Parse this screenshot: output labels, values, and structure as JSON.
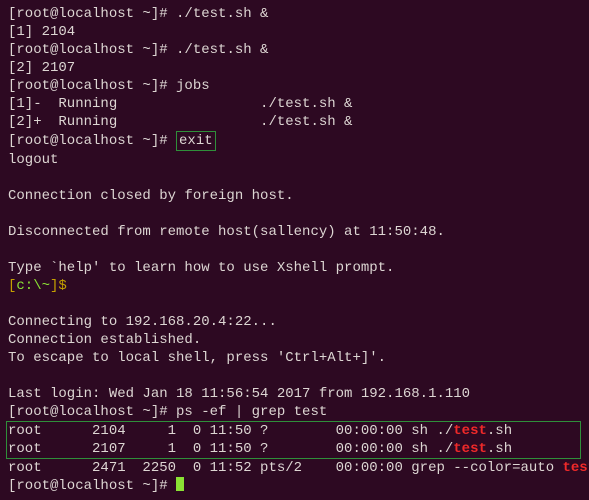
{
  "lines": {
    "prompt1": "[root@localhost ~]# ",
    "cmd1": "./test.sh &",
    "bg1": "[1] 2104",
    "prompt2": "[root@localhost ~]# ",
    "cmd2": "./test.sh &",
    "bg2": "[2] 2107",
    "prompt3": "[root@localhost ~]# ",
    "cmd3": "jobs",
    "jobs1": "[1]-  Running                 ./test.sh &",
    "jobs2": "[2]+  Running                 ./test.sh &",
    "prompt4": "[root@localhost ~]# ",
    "cmd4": "exit",
    "logout": "logout",
    "closed": "Connection closed by foreign host.",
    "disconnected": "Disconnected from remote host(sallency) at 11:50:48.",
    "help": "Type `help' to learn how to use Xshell prompt.",
    "localprompt": "[c:\\~]$",
    "connecting": "Connecting to 192.168.20.4:22...",
    "established": "Connection established.",
    "escape": "To escape to local shell, press 'Ctrl+Alt+]'.",
    "lastlogin": "Last login: Wed Jan 18 11:56:54 2017 from 192.168.1.110",
    "prompt5": "[root@localhost ~]# ",
    "cmd5": "ps -ef | grep test",
    "ps1a": "root      2104     1  0 11:50 ?        00:00:00 sh ./",
    "ps1b": "test",
    "ps1c": ".sh",
    "ps2a": "root      2107     1  0 11:50 ?        00:00:00 sh ./",
    "ps2b": "test",
    "ps2c": ".sh",
    "ps3a": "root      2471  2250  0 11:52 pts/2    00:00:00 grep --color=auto ",
    "ps3b": "test",
    "prompt6": "[root@localhost ~]# "
  }
}
